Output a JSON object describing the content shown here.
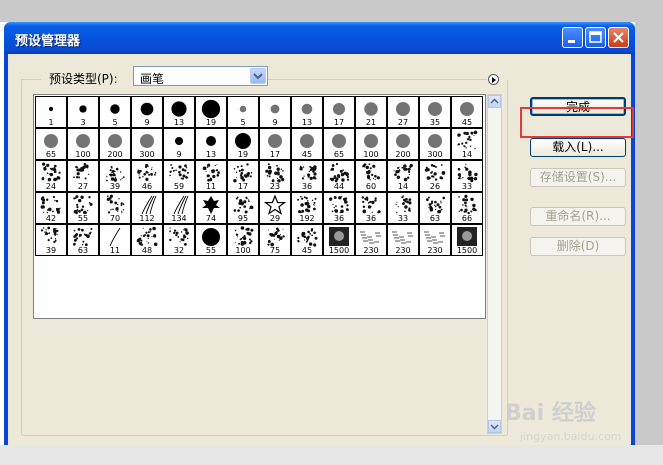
{
  "window": {
    "title": "预设管理器"
  },
  "preset": {
    "label": "预设类型(P):",
    "value": "画笔"
  },
  "buttons": {
    "done": "完成",
    "load": "载入(L)...",
    "save": "存储设置(S)...",
    "rename": "重命名(R)...",
    "delete": "删除(D)"
  },
  "brushes": [
    [
      "1",
      "3",
      "5",
      "9",
      "13",
      "19",
      "5",
      "9",
      "13",
      "17",
      "21",
      "27",
      "35",
      "45"
    ],
    [
      "65",
      "100",
      "200",
      "300",
      "9",
      "13",
      "19",
      "17",
      "45",
      "65",
      "100",
      "200",
      "300",
      "14"
    ],
    [
      "24",
      "27",
      "39",
      "46",
      "59",
      "11",
      "17",
      "23",
      "36",
      "44",
      "60",
      "14",
      "26",
      "33"
    ],
    [
      "42",
      "55",
      "70",
      "112",
      "134",
      "74",
      "95",
      "29",
      "192",
      "36",
      "36",
      "33",
      "63",
      "66"
    ],
    [
      "39",
      "63",
      "11",
      "48",
      "32",
      "55",
      "100",
      "75",
      "45",
      "1500",
      "230",
      "230",
      "230",
      "1500"
    ]
  ],
  "watermark": "Bai 经验",
  "watermark_url": "jingyan.baidu.com",
  "icons": [
    "minimize-icon",
    "maximize-icon",
    "close-icon",
    "dropdown-arrow-icon",
    "menu-arrow-icon",
    "scroll-up-icon",
    "scroll-down-icon"
  ]
}
